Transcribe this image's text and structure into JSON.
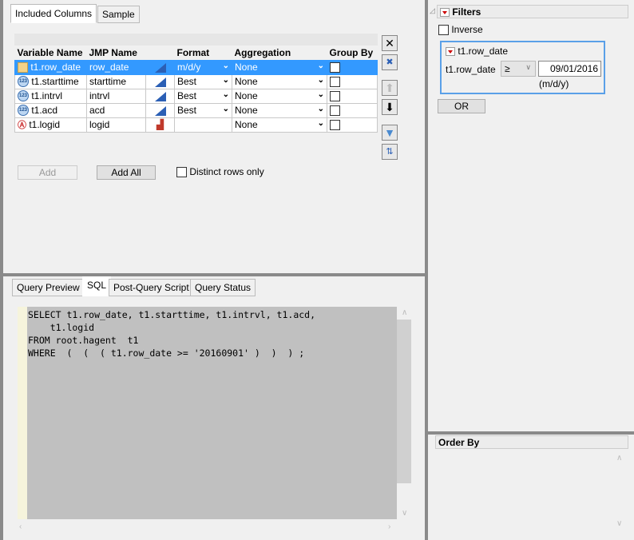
{
  "top_tabs": [
    "Included Columns",
    "Sample"
  ],
  "columns_table": {
    "headers": [
      "Variable Name",
      "JMP Name",
      "",
      "Format",
      "Aggregation",
      "Group By"
    ],
    "rows": [
      {
        "icon": "date-icon",
        "variable": "t1.row_date",
        "jmp": "row_date",
        "modeling": "continuous-icon",
        "format": "m/d/y",
        "aggregation": "None"
      },
      {
        "icon": "numeric-icon",
        "variable": "t1.starttime",
        "jmp": "starttime",
        "modeling": "continuous-icon",
        "format": "Best",
        "aggregation": "None"
      },
      {
        "icon": "numeric-icon",
        "variable": "t1.intrvl",
        "jmp": "intrvl",
        "modeling": "continuous-icon",
        "format": "Best",
        "aggregation": "None"
      },
      {
        "icon": "numeric-icon",
        "variable": "t1.acd",
        "jmp": "acd",
        "modeling": "continuous-icon",
        "format": "Best",
        "aggregation": "None"
      },
      {
        "icon": "character-icon",
        "variable": "t1.logid",
        "jmp": "logid",
        "modeling": "nominal-icon",
        "format": "",
        "aggregation": "None"
      }
    ]
  },
  "buttons": {
    "add": "Add",
    "add_all": "Add All",
    "distinct": "Distinct rows only"
  },
  "bottom_tabs": [
    "Query Preview",
    "SQL",
    "Post-Query Script",
    "Query Status"
  ],
  "sql": "SELECT t1.row_date, t1.starttime, t1.intrvl, t1.acd,\n    t1.logid\nFROM root.hagent  t1\nWHERE  (  (  ( t1.row_date >= '20160901' )  )  ) ;",
  "filters": {
    "title": "Filters",
    "inverse": "Inverse",
    "filter_title": "t1.row_date",
    "field_label": "t1.row_date",
    "operator": "≥",
    "value": "09/01/2016",
    "format_hint": "(m/d/y)",
    "or_button": "OR"
  },
  "order_by": {
    "title": "Order By"
  }
}
